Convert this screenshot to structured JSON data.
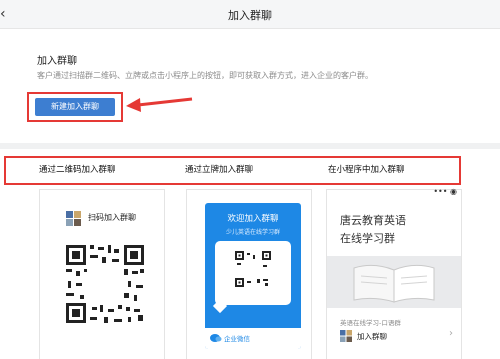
{
  "header": {
    "title": "加入群聊",
    "back_icon": "chevron-left-icon"
  },
  "intro": {
    "title": "加入群聊",
    "description": "客户通过扫描群二维码、立牌或点击小程序上的按钮，即可获取入群方式，进入企业的客户群。",
    "new_button_label": "新建加入群聊"
  },
  "options": {
    "qrcode_label": "通过二维码加入群聊",
    "standee_label": "通过立牌加入群聊",
    "miniprogram_label": "在小程序中加入群聊"
  },
  "cards": {
    "qrcode": {
      "title": "扫码加入群聊"
    },
    "standee": {
      "title": "欢迎加入群聊",
      "subtitle": "少儿英语在线学习群",
      "brand": "企业微信"
    },
    "miniprogram": {
      "title_line1": "唐云教育英语",
      "title_line2": "在线学习群",
      "source": "英语在线学习-口语群",
      "join_label": "加入群聊",
      "menu_icon": "more-dots-icon",
      "close_icon": "target-circle-icon"
    }
  },
  "colors": {
    "accent": "#3d7ed1",
    "highlight": "#e53935",
    "standee_blue": "#1e88e5"
  }
}
